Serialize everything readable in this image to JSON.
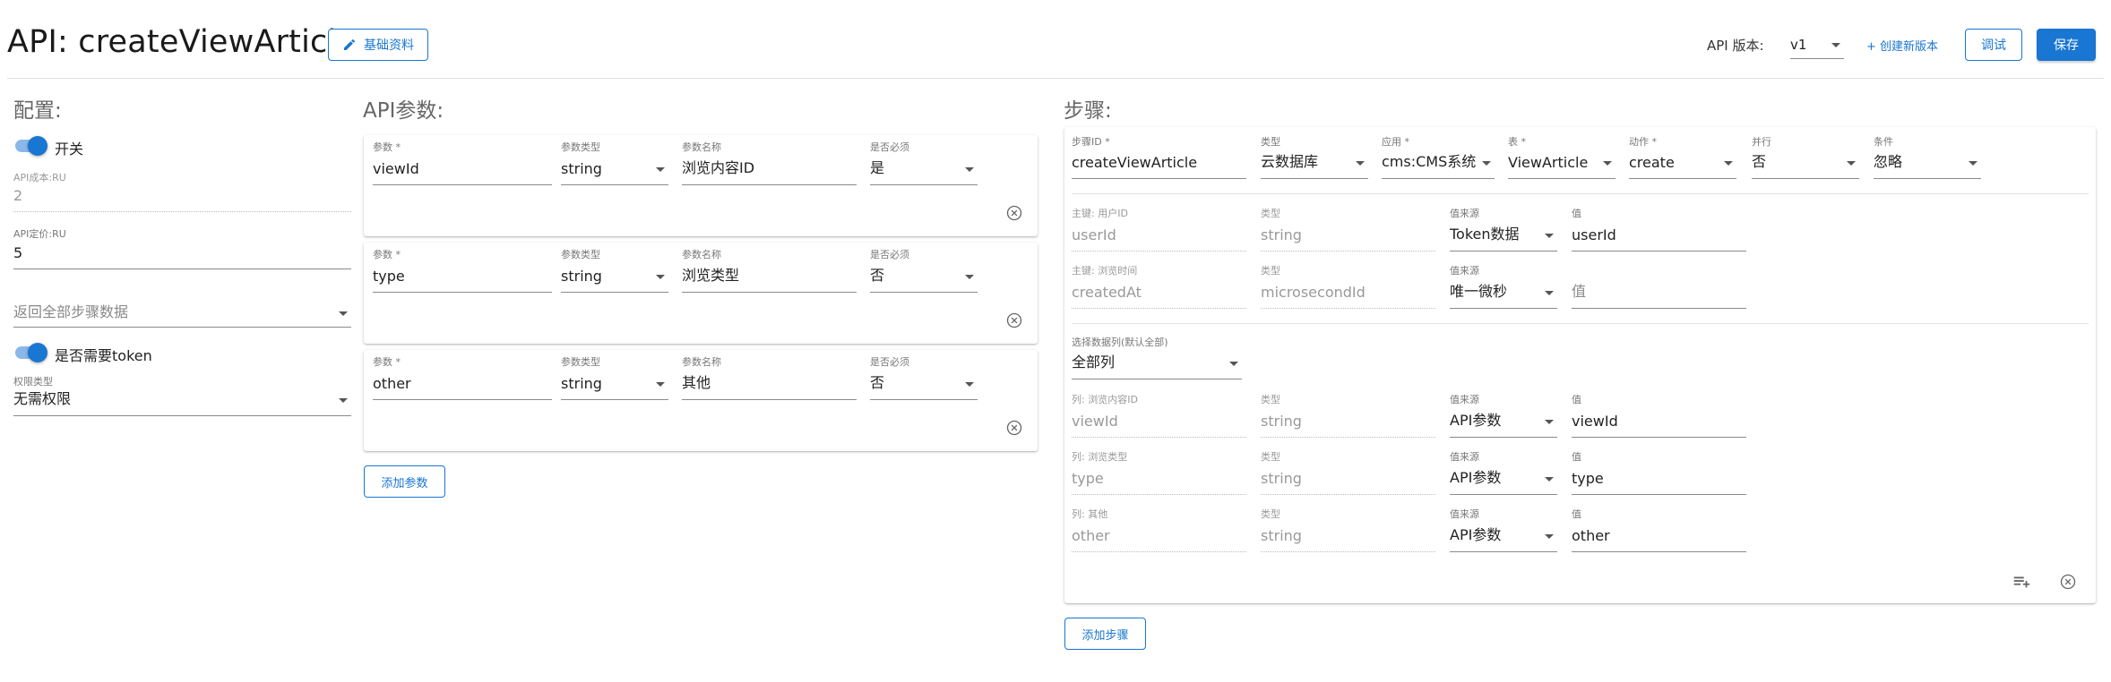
{
  "header": {
    "title": "API: createViewArticle",
    "basic_info_label": "基础资料",
    "version_label": "API 版本:",
    "version_value": "v1",
    "create_version_label": "+ 创建新版本",
    "debug_label": "调试",
    "save_label": "保存"
  },
  "config": {
    "title": "配置:",
    "switch_label": "开关",
    "switch_on": true,
    "cost_label": "API成本:RU",
    "cost_value": "2",
    "price_label": "API定价:RU",
    "price_value": "5",
    "return_placeholder": "返回全部步骤数据",
    "token_label": "是否需要token",
    "token_on": true,
    "permission_label": "权限类型",
    "permission_value": "无需权限"
  },
  "params": {
    "title": "API参数:",
    "col_param": "参数 *",
    "col_type": "参数类型",
    "col_name": "参数名称",
    "col_required": "是否必须",
    "rows": [
      {
        "param": "viewId",
        "type": "string",
        "name": "浏览内容ID",
        "required": "是"
      },
      {
        "param": "type",
        "type": "string",
        "name": "浏览类型",
        "required": "否"
      },
      {
        "param": "other",
        "type": "string",
        "name": "其他",
        "required": "否"
      }
    ],
    "add_label": "添加参数"
  },
  "steps": {
    "title": "步骤:",
    "step": {
      "id_label": "步骤ID *",
      "id_value": "createViewArticle",
      "kind_label": "类型",
      "kind_value": "云数据库",
      "app_label": "应用 *",
      "app_value": "cms:CMS系统",
      "table_label": "表 *",
      "table_value": "ViewArticle",
      "action_label": "动作 *",
      "action_value": "create",
      "parallel_label": "并行",
      "parallel_value": "否",
      "condition_label": "条件",
      "condition_value": "忽略"
    },
    "keys": [
      {
        "label": "主键: 用户ID",
        "value": "userId",
        "type_label": "类型",
        "type_value": "string",
        "source_label": "值来源",
        "source_value": "Token数据",
        "val_label": "值",
        "val_value": "userId"
      },
      {
        "label": "主键: 浏览时间",
        "value": "createdAt",
        "type_label": "类型",
        "type_value": "microsecondId",
        "source_label": "值来源",
        "source_value": "唯一微秒",
        "val_label": "",
        "val_value": "值"
      }
    ],
    "columns_select_label": "选择数据列(默认全部)",
    "columns_select_value": "全部列",
    "columns": [
      {
        "label": "列: 浏览内容ID",
        "value": "viewId",
        "type_label": "类型",
        "type_value": "string",
        "source_label": "值来源",
        "source_value": "API参数",
        "val_label": "值",
        "val_value": "viewId"
      },
      {
        "label": "列: 浏览类型",
        "value": "type",
        "type_label": "类型",
        "type_value": "string",
        "source_label": "值来源",
        "source_value": "API参数",
        "val_label": "值",
        "val_value": "type"
      },
      {
        "label": "列: 其他",
        "value": "other",
        "type_label": "类型",
        "type_value": "string",
        "source_label": "值来源",
        "source_value": "API参数",
        "val_label": "值",
        "val_value": "other"
      }
    ],
    "add_label": "添加步骤"
  },
  "icons": {
    "edit": "pencil-icon",
    "remove": "close-circle-icon",
    "add_row": "playlist-add-icon",
    "dropdown": "caret-down-icon"
  },
  "colors": {
    "primary": "#1976d2",
    "toggle_track": "#8ab8e8"
  }
}
